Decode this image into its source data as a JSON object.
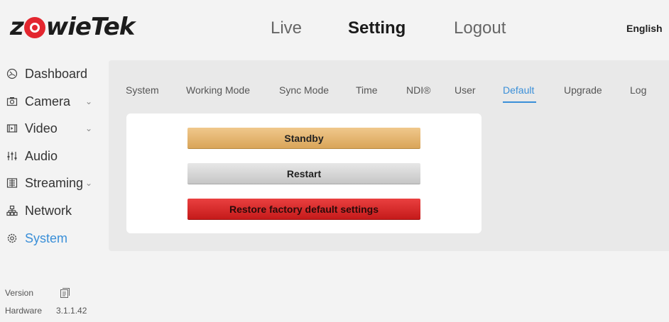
{
  "brand": {
    "name": "ZowieTek",
    "part1": "z",
    "part2": "wie",
    "part3": "Tek",
    "accent": "#e3262f"
  },
  "header": {
    "nav": [
      {
        "label": "Live",
        "active": false
      },
      {
        "label": "Setting",
        "active": true
      },
      {
        "label": "Logout",
        "active": false
      }
    ],
    "language": "English"
  },
  "sidebar": {
    "items": [
      {
        "label": "Dashboard",
        "icon": "dashboard-icon"
      },
      {
        "label": "Camera",
        "icon": "camera-icon",
        "expandable": true
      },
      {
        "label": "Video",
        "icon": "video-icon",
        "expandable": true
      },
      {
        "label": "Audio",
        "icon": "audio-icon"
      },
      {
        "label": "Streaming",
        "icon": "streaming-icon",
        "expandable": true
      },
      {
        "label": "Network",
        "icon": "network-icon"
      },
      {
        "label": "System",
        "icon": "gear-icon",
        "active": true
      }
    ],
    "version_label": "Version",
    "hardware_label": "Hardware",
    "hardware_value": "3.1.1.42"
  },
  "tabs": [
    {
      "label": "System"
    },
    {
      "label": "Working Mode"
    },
    {
      "label": "Sync Mode"
    },
    {
      "label": "Time"
    },
    {
      "label": "NDI®"
    },
    {
      "label": "User"
    },
    {
      "label": "Default",
      "active": true
    },
    {
      "label": "Upgrade"
    },
    {
      "label": "Log"
    }
  ],
  "actions": {
    "standby_label": "Standby",
    "restart_label": "Restart",
    "restore_label": "Restore factory default settings"
  },
  "colors": {
    "active": "#3a8fd8",
    "standby": "#dfae64",
    "restart": "#d0d0d0",
    "restore": "#d62a2a"
  }
}
